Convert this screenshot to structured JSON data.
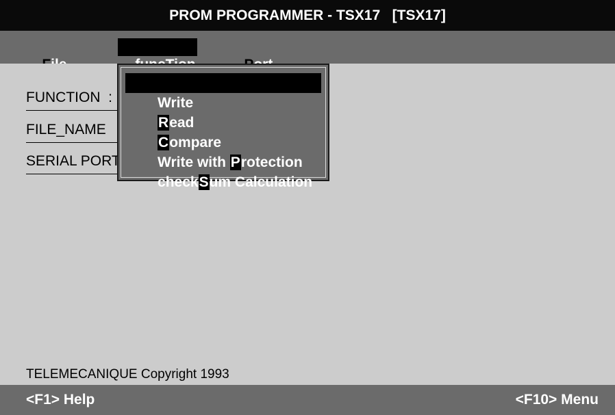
{
  "window": {
    "title": "PROM PROGRAMMER - TSX17   [TSX17]"
  },
  "menubar": {
    "items": [
      {
        "hotkey": "F",
        "rest": "ile"
      },
      {
        "pre": "func",
        "hotkey": "T",
        "rest": "ion"
      },
      {
        "hotkey": "P",
        "rest": "ort"
      }
    ]
  },
  "dropdown": {
    "items": [
      {
        "label": "Write"
      },
      {
        "hotkey": "R",
        "rest": "ead"
      },
      {
        "hotkey": "C",
        "rest": "ompare"
      },
      {
        "pre": "Write with ",
        "hotkey": "P",
        "rest": "rotection"
      },
      {
        "pre": "check",
        "hotkey": "S",
        "rest": "um Calculation"
      }
    ]
  },
  "fields": {
    "function_label": "FUNCTION  :",
    "file_name_label": "FILE_NAME",
    "serial_port_label": "SERIAL PORT"
  },
  "footer": {
    "copyright": "TELEMECANIQUE Copyright 1993"
  },
  "statusbar": {
    "help": "<F1> Help",
    "menu": "<F10> Menu"
  },
  "colors": {
    "title_bg": "#0a0a0a",
    "menu_bg": "#6b6b6b",
    "body_bg": "#cccccc"
  }
}
